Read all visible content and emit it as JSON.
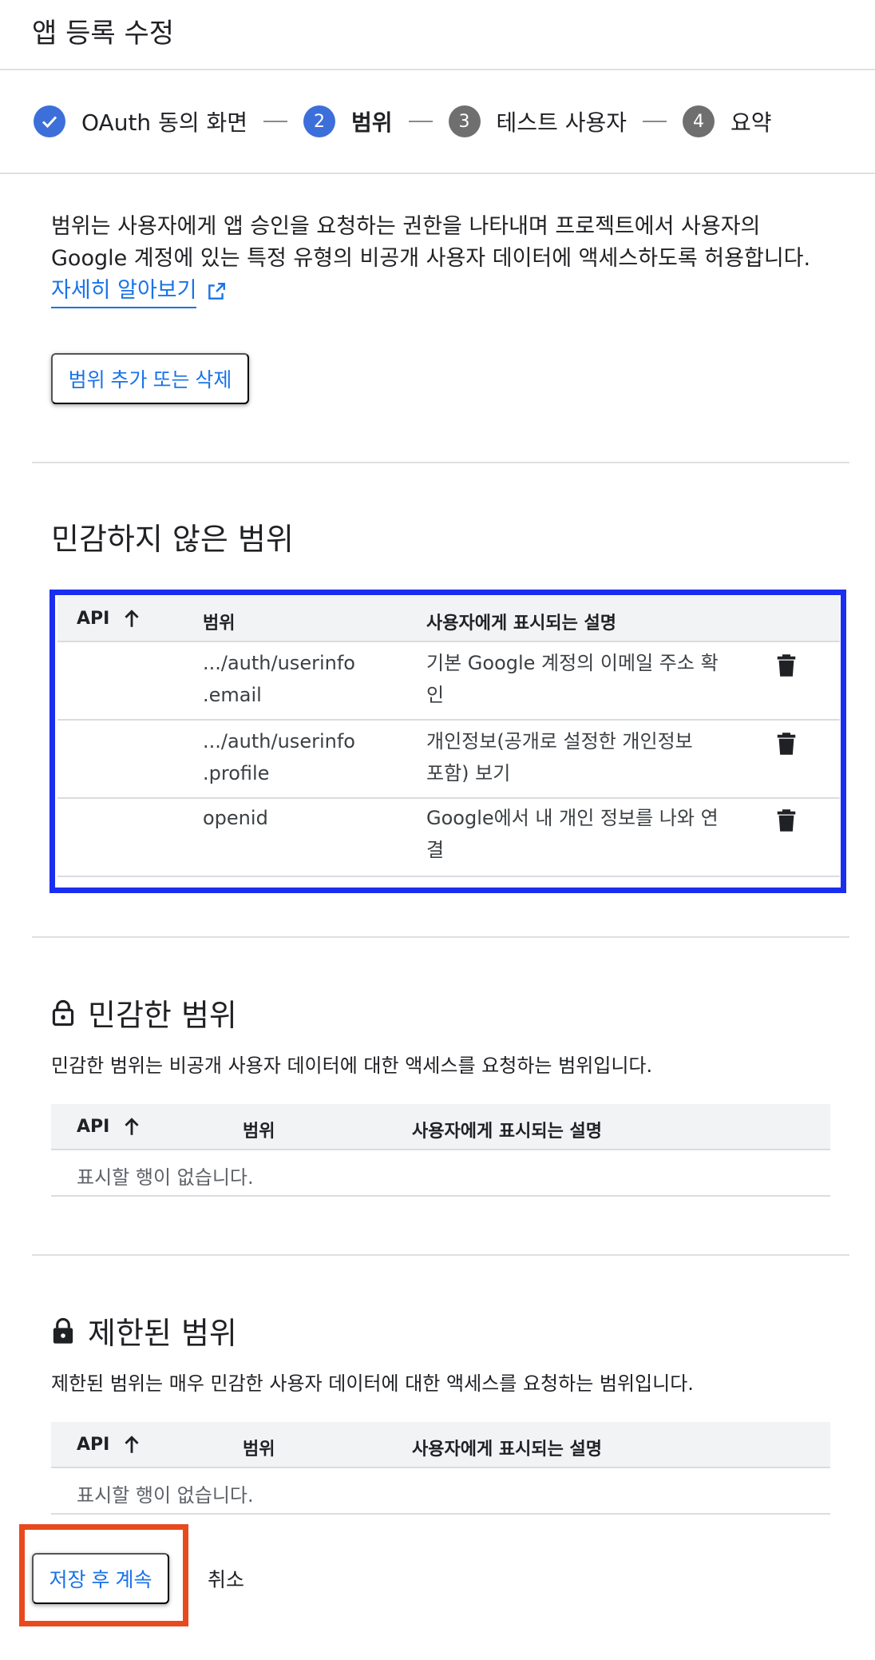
{
  "header": {
    "title": "앱 등록 수정"
  },
  "stepper": {
    "steps": [
      {
        "number": "",
        "label": "OAuth 동의 화면"
      },
      {
        "number": "2",
        "label": "범위"
      },
      {
        "number": "3",
        "label": "테스트 사용자"
      },
      {
        "number": "4",
        "label": "요약"
      }
    ]
  },
  "intro": {
    "text": "범위는 사용자에게 앱 승인을 요청하는 권한을 나타내며 프로젝트에서 사용자의 Google 계정에 있는 특정 유형의 비공개 사용자 데이터에 액세스하도록 허용합니다.",
    "learn_more": "자세히 알아보기",
    "add_remove_button": "범위 추가 또는 삭제"
  },
  "table_headers": {
    "api": "API",
    "scope": "범위",
    "description": "사용자에게 표시되는 설명"
  },
  "non_sensitive": {
    "title": "민감하지 않은 범위",
    "rows": [
      {
        "scope_line1": ".../auth/userinfo",
        "scope_line2": ".email",
        "desc_line1": "기본 Google 계정의 이메일 주소 확",
        "desc_line2": "인"
      },
      {
        "scope_line1": ".../auth/userinfo",
        "scope_line2": ".profile",
        "desc_line1": "개인정보(공개로 설정한 개인정보",
        "desc_line2": "포함) 보기"
      },
      {
        "scope_line1": "openid",
        "scope_line2": "",
        "desc_line1": "Google에서 내 개인 정보를 나와 연",
        "desc_line2": "결"
      }
    ]
  },
  "sensitive": {
    "title": "민감한 범위",
    "description": "민감한 범위는 비공개 사용자 데이터에 대한 액세스를 요청하는 범위입니다.",
    "empty": "표시할 행이 없습니다."
  },
  "restricted": {
    "title": "제한된 범위",
    "description": "제한된 범위는 매우 민감한 사용자 데이터에 대한 액세스를 요청하는 범위입니다.",
    "empty": "표시할 행이 없습니다."
  },
  "footer": {
    "save": "저장 후 계속",
    "cancel": "취소"
  },
  "colors": {
    "accent": "#1a73e8",
    "step_active": "#3c6fd9",
    "highlight_blue": "#1a2ef0",
    "highlight_red": "#e84a1e"
  }
}
